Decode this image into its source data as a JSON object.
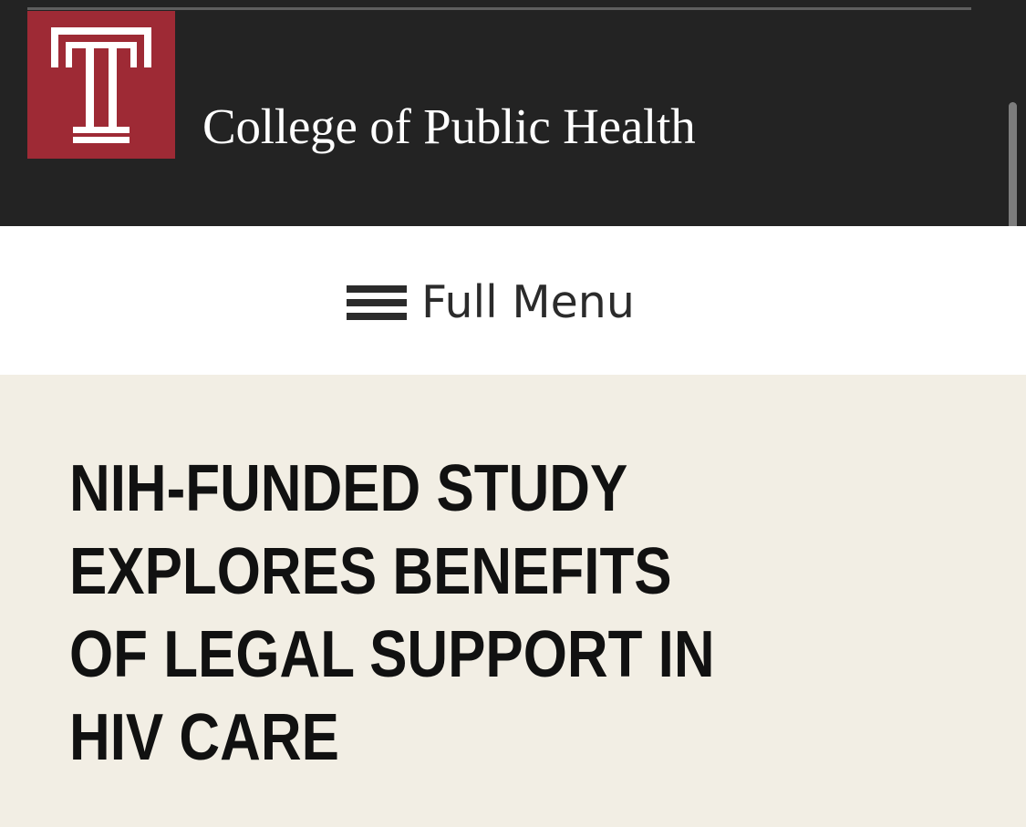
{
  "header": {
    "logo": {
      "icon": "temple-t-logo-icon",
      "color": "#9e2a35"
    },
    "site_name": "College of Public Health",
    "background": "#232323"
  },
  "nav": {
    "menu_icon": "hamburger-icon",
    "menu_label": "Full Menu"
  },
  "article": {
    "title": "NIH-FUNDED STUDY EXPLORES BENEFITS OF LEGAL SUPPORT IN HIV CARE",
    "background": "#f2eee4"
  }
}
